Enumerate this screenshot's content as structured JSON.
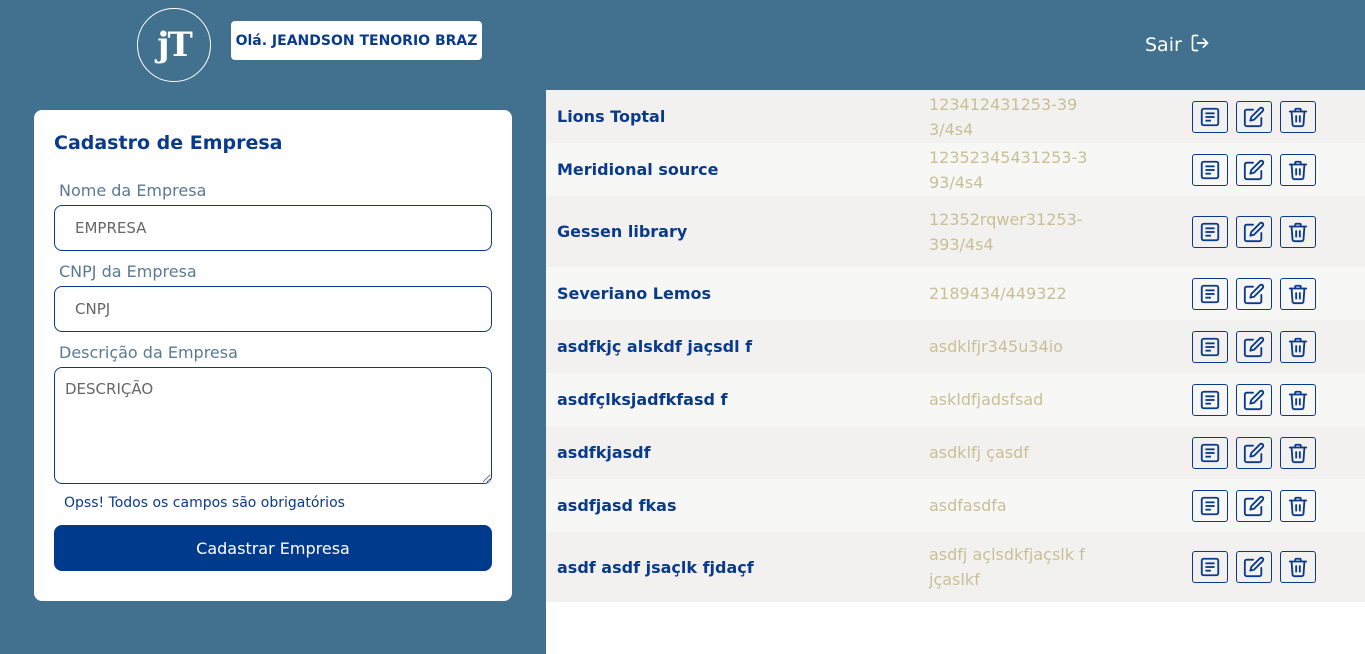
{
  "header": {
    "logo_text": "jT",
    "greeting": "Olá. JEANDSON TENORIO BRAZ",
    "logout_label": "Sair"
  },
  "form": {
    "title": "Cadastro de Empresa",
    "name_label": "Nome da Empresa",
    "name_placeholder": "EMPRESA",
    "cnpj_label": "CNPJ da Empresa",
    "cnpj_placeholder": "CNPJ",
    "desc_label": "Descrição da Empresa",
    "desc_placeholder": "DESCRIÇÃO",
    "error_message": "Opss! Todos os campos são obrigatórios",
    "submit_label": "Cadastrar Empresa"
  },
  "companies": [
    {
      "name": "Lions Toptal",
      "cnpj": "123412431253-393/4s4"
    },
    {
      "name": "Meridional source",
      "cnpj": "12352345431253-393/4s4"
    },
    {
      "name": "Gessen library",
      "cnpj": "12352rqwer31253-393/4s4"
    },
    {
      "name": "Severiano Lemos",
      "cnpj": "2189434/449322"
    },
    {
      "name": "asdfkjç alskdf jaçsdl f",
      "cnpj": "asdklfjr345u34io"
    },
    {
      "name": "asdfçlksjadfkfasd f",
      "cnpj": "askldfjadsfsad"
    },
    {
      "name": "asdfkjasdf",
      "cnpj": "asdklfj çasdf"
    },
    {
      "name": "asdfjasd fkas",
      "cnpj": "asdfasdfa"
    },
    {
      "name": "asdf asdf jsaçlk fjdaçf",
      "cnpj": "asdfj açlsdkfjaçslk fjçaslkf"
    }
  ],
  "icons": {
    "details": "details-icon",
    "edit": "edit-icon",
    "delete": "trash-icon",
    "logout": "logout-icon"
  },
  "colors": {
    "background": "#42718f",
    "primary": "#0a3a8c",
    "button": "#003a8c",
    "cnpj_text": "#c9bf95"
  }
}
